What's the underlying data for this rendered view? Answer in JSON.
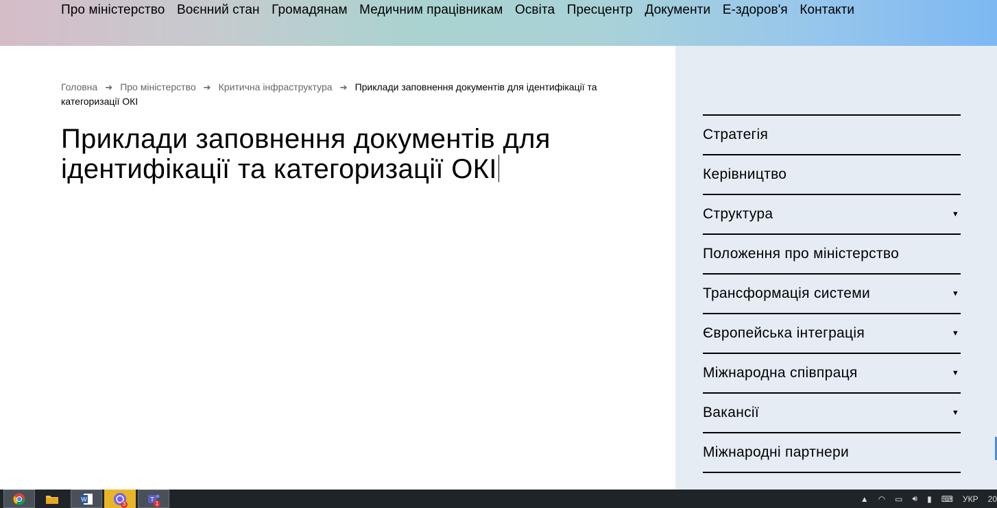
{
  "nav": {
    "items": [
      "Про міністерство",
      "Воєнний стан",
      "Громадянам",
      "Медичним працівникам",
      "Освіта",
      "Пресцентр",
      "Документи",
      "Е-здоров'я",
      "Контакти"
    ]
  },
  "breadcrumb": {
    "items": [
      "Головна",
      "Про міністерство",
      "Критична інфраструктура"
    ],
    "separator": "➔",
    "current": "Приклади заповнення документів для ідентифікації та категоризації ОКІ"
  },
  "page": {
    "title": "Приклади заповнення документів для ідентифікації та категоризації ОКІ"
  },
  "sidebar": {
    "items": [
      {
        "label": "Стратегія",
        "expandable": false
      },
      {
        "label": "Керівництво",
        "expandable": false
      },
      {
        "label": "Структура",
        "expandable": true
      },
      {
        "label": "Положення про міністерство",
        "expandable": false
      },
      {
        "label": "Трансформація системи",
        "expandable": true
      },
      {
        "label": "Європейська інтеграція",
        "expandable": true
      },
      {
        "label": "Міжнародна співпраця",
        "expandable": true
      },
      {
        "label": "Вакансії",
        "expandable": true
      },
      {
        "label": "Міжнародні партнери",
        "expandable": false
      }
    ],
    "arrow_glyph": "▼"
  },
  "taskbar": {
    "apps": [
      {
        "name": "chrome",
        "icon": "chrome-icon"
      },
      {
        "name": "file-explorer",
        "icon": "folder-icon"
      },
      {
        "name": "word",
        "icon": "word-icon"
      },
      {
        "name": "viber",
        "icon": "viber-icon",
        "badge": "3"
      },
      {
        "name": "teams",
        "icon": "teams-icon",
        "badge": "1"
      }
    ],
    "language": "УКР",
    "clock_partial": "20"
  },
  "colors": {
    "sidebar_bg": "#e5ecf3",
    "nav_gradient_start": "#d6bcc8",
    "nav_gradient_end": "#7db8f3",
    "taskbar_bg": "#1f2428"
  }
}
